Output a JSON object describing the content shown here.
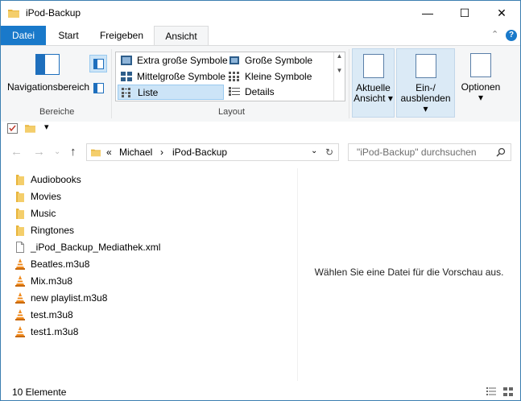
{
  "window": {
    "title": "iPod-Backup",
    "controls": {
      "minimize": "—",
      "maximize": "☐",
      "close": "✕"
    }
  },
  "ribbon": {
    "tabs": [
      {
        "label": "Datei"
      },
      {
        "label": "Start"
      },
      {
        "label": "Freigeben"
      },
      {
        "label": "Ansicht"
      }
    ],
    "groups": {
      "bereiche": {
        "label": "Bereiche",
        "nav_button": "Navigationsbereich"
      },
      "layout": {
        "label": "Layout",
        "options": [
          {
            "label": "Extra große Symbole"
          },
          {
            "label": "Große Symbole"
          },
          {
            "label": "Mittelgroße Symbole"
          },
          {
            "label": "Kleine Symbole"
          },
          {
            "label": "Liste"
          },
          {
            "label": "Details"
          }
        ]
      },
      "current_view": {
        "line1": "Aktuelle",
        "line2": "Ansicht"
      },
      "show_hide": {
        "line1": "Ein-/",
        "line2": "ausblenden"
      },
      "options": {
        "label": "Optionen"
      }
    }
  },
  "address": {
    "overflow": "«",
    "crumbs": [
      {
        "label": "Michael"
      },
      {
        "label": "iPod-Backup"
      }
    ],
    "separator": "›"
  },
  "search": {
    "placeholder": "\"iPod-Backup\" durchsuchen"
  },
  "files": [
    {
      "name": "Audiobooks",
      "icon": "folder-icon"
    },
    {
      "name": "Movies",
      "icon": "folder-icon"
    },
    {
      "name": "Music",
      "icon": "folder-icon"
    },
    {
      "name": "Ringtones",
      "icon": "folder-icon"
    },
    {
      "name": "_iPod_Backup_Mediathek.xml",
      "icon": "document-icon"
    },
    {
      "name": "Beatles.m3u8",
      "icon": "vlc-cone-icon"
    },
    {
      "name": "Mix.m3u8",
      "icon": "vlc-cone-icon"
    },
    {
      "name": "new playlist.m3u8",
      "icon": "vlc-cone-icon"
    },
    {
      "name": "test.m3u8",
      "icon": "vlc-cone-icon"
    },
    {
      "name": "test1.m3u8",
      "icon": "vlc-cone-icon"
    }
  ],
  "preview": {
    "text": "Wählen Sie eine Datei für die Vorschau aus."
  },
  "status": {
    "count": "10 Elemente"
  },
  "colors": {
    "accent": "#1979ca",
    "folder": "#e8b53c",
    "selection": "#cce4f7",
    "vlc": "#f08a1c"
  }
}
